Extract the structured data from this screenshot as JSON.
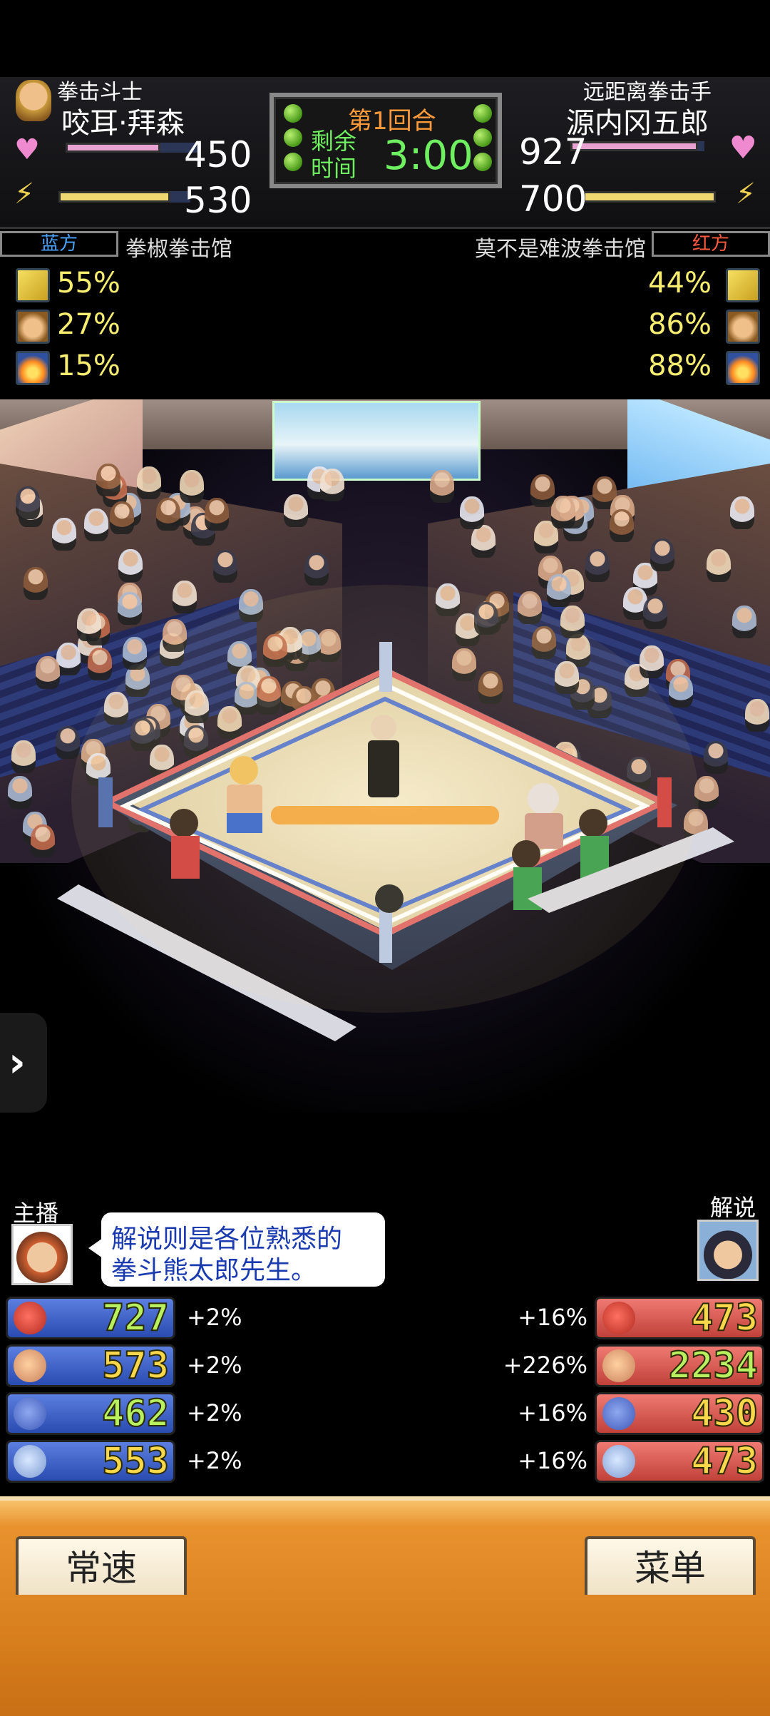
{
  "left_fighter": {
    "type": "拳击斗士",
    "name": "咬耳·拜森",
    "hp": "450",
    "energy": "530",
    "side": "蓝方",
    "gym": "拳椒拳击馆",
    "hp_fill": 0.7,
    "energy_fill": 0.85
  },
  "right_fighter": {
    "type": "远距离拳击手",
    "name": "源内冈五郎",
    "hp": "927",
    "energy": "700",
    "side": "红方",
    "gym": "莫不是难波拳击馆",
    "hp_fill": 0.95,
    "energy_fill": 1.0
  },
  "round": {
    "label": "第1回合",
    "remaining_1": "剩余",
    "remaining_2": "时间",
    "time": "3:00"
  },
  "left_pcts": [
    "55%",
    "27%",
    "15%"
  ],
  "right_pcts": [
    "44%",
    "86%",
    "88%"
  ],
  "commentary": {
    "host_label": "主播",
    "commentator_label": "解说",
    "bubble_line1": "解说则是各位熟悉的",
    "bubble_line2": "拳斗熊太郎先生。"
  },
  "left_stats": [
    {
      "value": "727",
      "bonus": "+2%",
      "icon": "boxing-glove-icon"
    },
    {
      "value": "573",
      "bonus": "+2%",
      "icon": "muscle-arm-icon"
    },
    {
      "value": "462",
      "bonus": "+2%",
      "icon": "body-icon"
    },
    {
      "value": "553",
      "bonus": "+2%",
      "icon": "shoe-icon"
    }
  ],
  "right_stats": [
    {
      "value": "473",
      "bonus": "+16%",
      "icon": "boxing-glove-icon"
    },
    {
      "value": "2234",
      "bonus": "+226%",
      "icon": "muscle-arm-icon"
    },
    {
      "value": "430",
      "bonus": "+16%",
      "icon": "body-icon"
    },
    {
      "value": "473",
      "bonus": "+16%",
      "icon": "shoe-icon"
    }
  ],
  "buttons": {
    "speed": "常速",
    "menu": "菜单"
  },
  "colors": {
    "blue_side": "#4aa3ff",
    "red_side": "#ff5a40",
    "time_green": "#6ff060",
    "round_orange": "#ff9a3a",
    "pct_yellow": "#f7ee70"
  }
}
